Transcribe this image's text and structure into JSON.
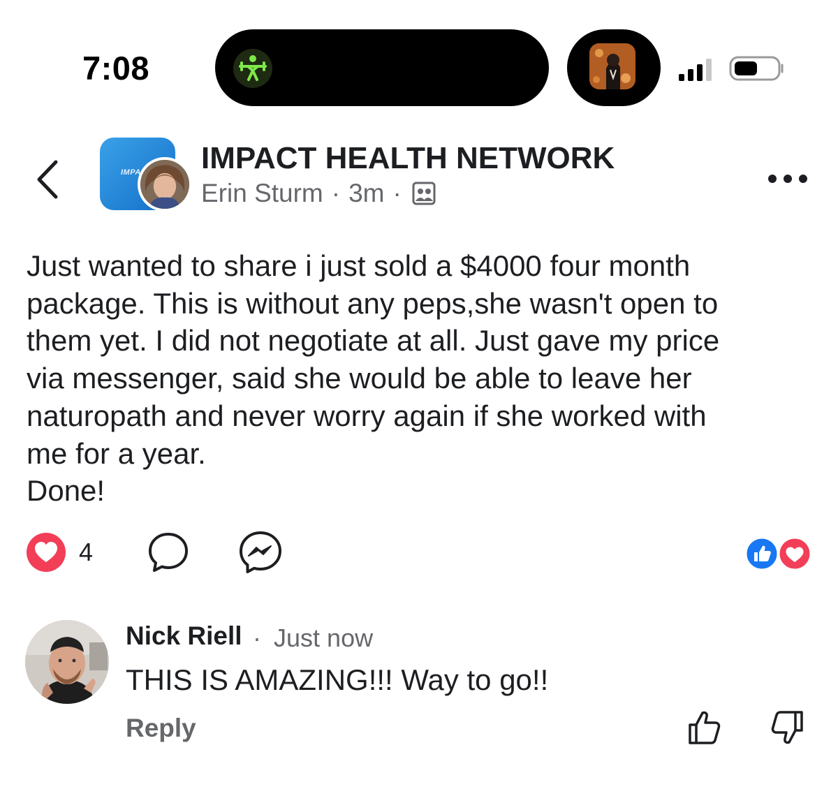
{
  "status_bar": {
    "time": "7:08",
    "icons": [
      "workout-activity-icon",
      "now-playing-artwork",
      "cellular-signal-icon",
      "battery-icon"
    ],
    "accent": "#7ee84a"
  },
  "header": {
    "back_icon": "chevron-left-icon",
    "group_name": "IMPACT HEALTH NETWORK",
    "group_avatar_text": "IMPA",
    "author": "Erin Sturm",
    "separator": "·",
    "time_ago": "3m",
    "audience_icon": "group-members-icon",
    "more_icon": "more-dots-icon"
  },
  "post": {
    "lines": [
      "Just wanted to share i just sold a $4000 four month",
      "package. This is without any peps,she wasn't open to",
      "them yet. I did not negotiate at all. Just gave my price",
      "via messenger, said she would be able to leave her",
      "naturopath and never worry again if she worked with",
      "me for a year.",
      "Done!"
    ]
  },
  "actions": {
    "reaction_icon": "heart-reaction-icon",
    "reaction_count": "4",
    "comment_icon": "comment-bubble-icon",
    "share_icon": "messenger-icon",
    "summary_icons": [
      "like-reaction-icon",
      "love-reaction-icon"
    ],
    "colors": {
      "love": "#f33e58",
      "like": "#1877f2"
    }
  },
  "comment": {
    "name": "Nick Riell",
    "separator": "·",
    "time": "Just now",
    "text": "THIS IS AMAZING!!! Way to go!!",
    "reply_label": "Reply",
    "upvote_icon": "thumbs-up-outline-icon",
    "downvote_icon": "thumbs-down-outline-icon"
  }
}
